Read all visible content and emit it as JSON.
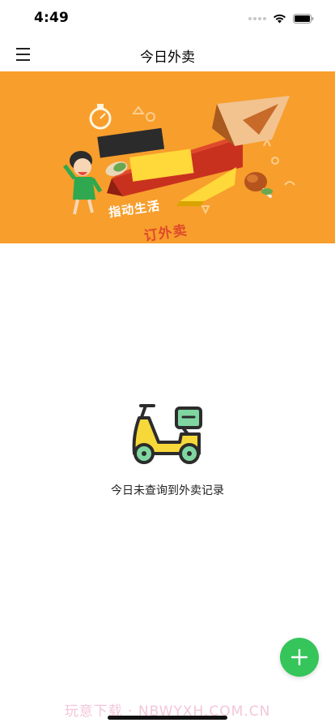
{
  "status_bar": {
    "time": "4:49",
    "icons": [
      "signal-dots-icon",
      "wifi-icon",
      "battery-icon"
    ]
  },
  "header": {
    "title": "今日外卖",
    "menu_icon": "hamburger-menu-icon"
  },
  "banner": {
    "headline_line1": "指动生活",
    "headline_line2": "订外卖",
    "background_color": "#f79e2c"
  },
  "empty_state": {
    "icon": "scooter-icon",
    "message": "今日未查询到外卖记录"
  },
  "fab": {
    "icon": "plus-icon",
    "color": "#35c55a"
  },
  "watermark": {
    "text": "玩意下载 · NBWYXH.COM.CN"
  }
}
